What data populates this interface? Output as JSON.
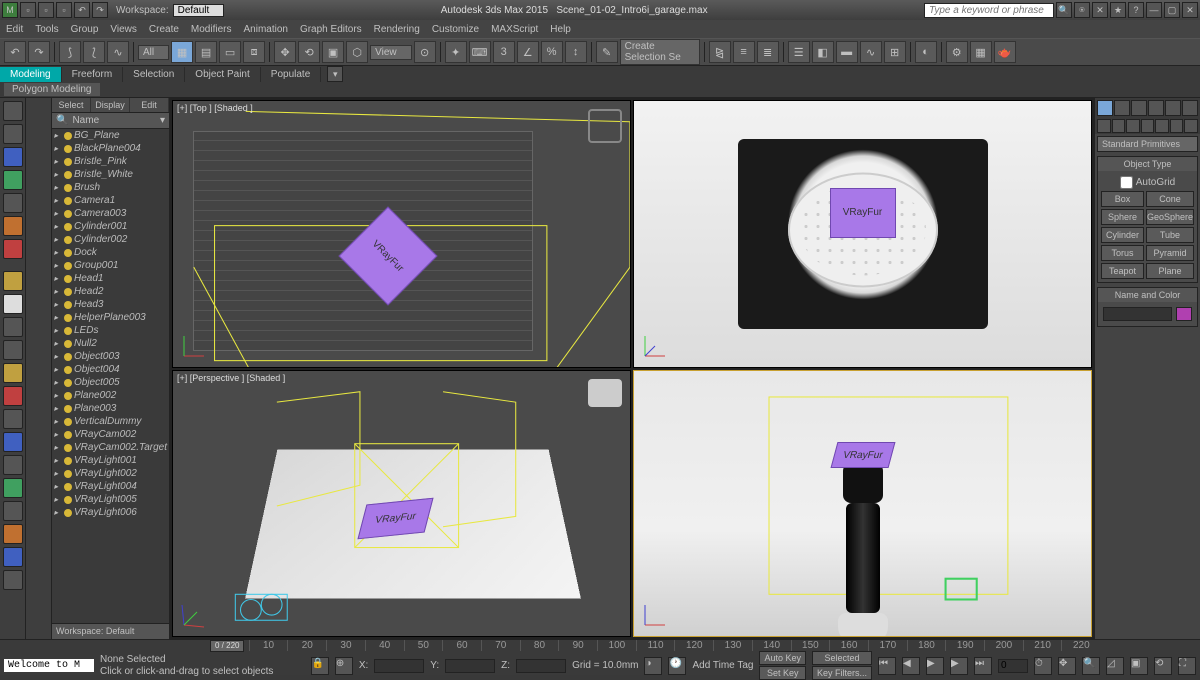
{
  "title_bar": {
    "workspace_label": "Workspace:",
    "workspace_value": "Default",
    "app_title": "Autodesk 3ds Max 2015",
    "scene_name": "Scene_01-02_Intro6i_garage.max",
    "search_placeholder": "Type a keyword or phrase"
  },
  "menu": [
    "Edit",
    "Tools",
    "Group",
    "Views",
    "Create",
    "Modifiers",
    "Animation",
    "Graph Editors",
    "Rendering",
    "Customize",
    "MAXScript",
    "Help"
  ],
  "main_toolbar": {
    "filter_dd": "All",
    "view_dd": "View",
    "selset_dd": "Create Selection Se"
  },
  "ribbon": {
    "tabs": [
      "Modeling",
      "Freeform",
      "Selection",
      "Object Paint",
      "Populate"
    ],
    "sub": "Polygon Modeling"
  },
  "scene_explorer": {
    "hdr": [
      "Select",
      "Display",
      "Edit"
    ],
    "name_col": "Name",
    "items": [
      "BG_Plane",
      "BlackPlane004",
      "Bristle_Pink",
      "Bristle_White",
      "Brush",
      "Camera1",
      "Camera003",
      "Cylinder001",
      "Cylinder002",
      "Dock",
      "Group001",
      "Head1",
      "Head2",
      "Head3",
      "HelperPlane003",
      "LEDs",
      "Null2",
      "Object003",
      "Object004",
      "Object005",
      "Plane002",
      "Plane003",
      "VerticalDummy",
      "VRayCam002",
      "VRayCam002.Target",
      "VRayLight001",
      "VRayLight002",
      "VRayLight004",
      "VRayLight005",
      "VRayLight006"
    ],
    "ws_footer": "Workspace: Default"
  },
  "viewports": {
    "v0": "[+] [Top ] [Shaded ]",
    "v1_plane": "VRayFur",
    "v2": "[+] [Perspective ] [Shaded ]",
    "v2_plane": "VRayFur",
    "v3_plane": "VRayFur"
  },
  "command_panel": {
    "dropdown": "Standard Primitives",
    "rollout_obj": "Object Type",
    "autogrid": "AutoGrid",
    "buttons": [
      "Box",
      "Cone",
      "Sphere",
      "GeoSphere",
      "Cylinder",
      "Tube",
      "Torus",
      "Pyramid",
      "Teapot",
      "Plane"
    ],
    "rollout_name": "Name and Color"
  },
  "timeline": {
    "current": "0 / 220",
    "ticks": [
      "0",
      "10",
      "20",
      "30",
      "40",
      "50",
      "60",
      "70",
      "80",
      "90",
      "100",
      "110",
      "120",
      "130",
      "140",
      "150",
      "160",
      "170",
      "180",
      "190",
      "200",
      "210",
      "220"
    ]
  },
  "status": {
    "welcome": "Welcome to M",
    "none_selected": "None Selected",
    "prompt": "Click or click-and-drag to select objects",
    "x": "X:",
    "y": "Y:",
    "z": "Z:",
    "grid": "Grid = 10.0mm",
    "add_tag": "Add Time Tag",
    "autokey": "Auto Key",
    "setkey": "Set Key",
    "selected": "Selected",
    "keyfilters": "Key Filters..."
  }
}
